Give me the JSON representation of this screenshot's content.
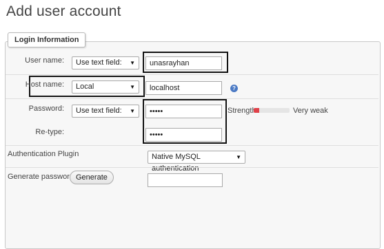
{
  "page": {
    "title": "Add user account"
  },
  "login_info": {
    "legend": "Login Information",
    "user_name": {
      "label": "User name:",
      "mode": "Use text field:",
      "value": "unasrayhan"
    },
    "host_name": {
      "label": "Host name:",
      "mode": "Local",
      "value": "localhost",
      "help_icon": "help-icon"
    },
    "password": {
      "label": "Password:",
      "mode": "Use text field:",
      "value": "•••••",
      "strength_label": "Strength:",
      "strength_text": "Very weak",
      "strength_fraction": 0.15,
      "strength_color": "#e0424a"
    },
    "retype": {
      "label": "Re-type:",
      "value": "•••••"
    }
  },
  "auth_plugin": {
    "label": "Authentication Plugin",
    "selected": "Native MySQL authentication"
  },
  "generate": {
    "label": "Generate password:",
    "button": "Generate",
    "value": ""
  }
}
